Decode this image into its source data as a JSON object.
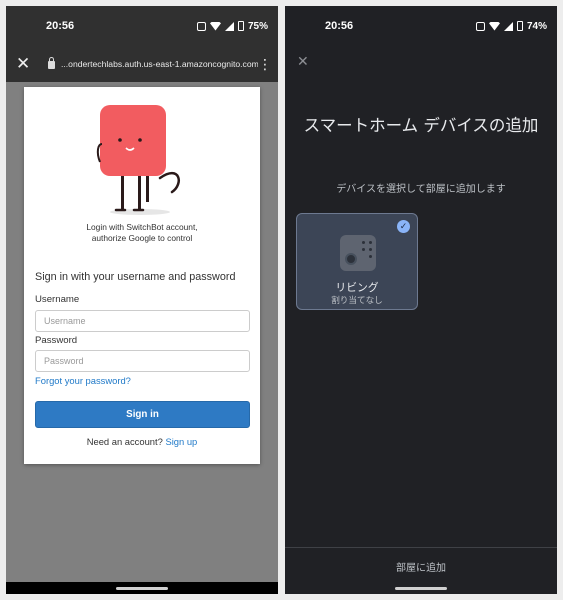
{
  "left": {
    "status": {
      "time": "20:56",
      "battery": "75%"
    },
    "url_bar": {
      "url": "...ondertechlabs.auth.us-east-1.amazoncognito.com"
    },
    "card": {
      "login_line1": "Login with SwitchBot account,",
      "login_line2": "authorize Google to control",
      "heading": "Sign in with your username and password",
      "username_label": "Username",
      "username_placeholder": "Username",
      "password_label": "Password",
      "password_placeholder": "Password",
      "forgot_link": "Forgot your password?",
      "signin_button": "Sign in",
      "need_account": "Need an account?",
      "signup_link": "Sign up"
    }
  },
  "right": {
    "status": {
      "time": "20:56",
      "battery": "74%"
    },
    "title": "スマートホーム デバイスの追加",
    "subtitle": "デバイスを選択して部屋に追加します",
    "device": {
      "name": "リビング",
      "assignment": "割り当てなし"
    },
    "add_room_button": "部屋に追加"
  },
  "colors": {
    "signin_blue": "#2e7ac4",
    "link_blue": "#1f79c8",
    "tile_bg": "#3c4556",
    "check_blue": "#8ab4f8",
    "mascot_red": "#f25c60"
  }
}
